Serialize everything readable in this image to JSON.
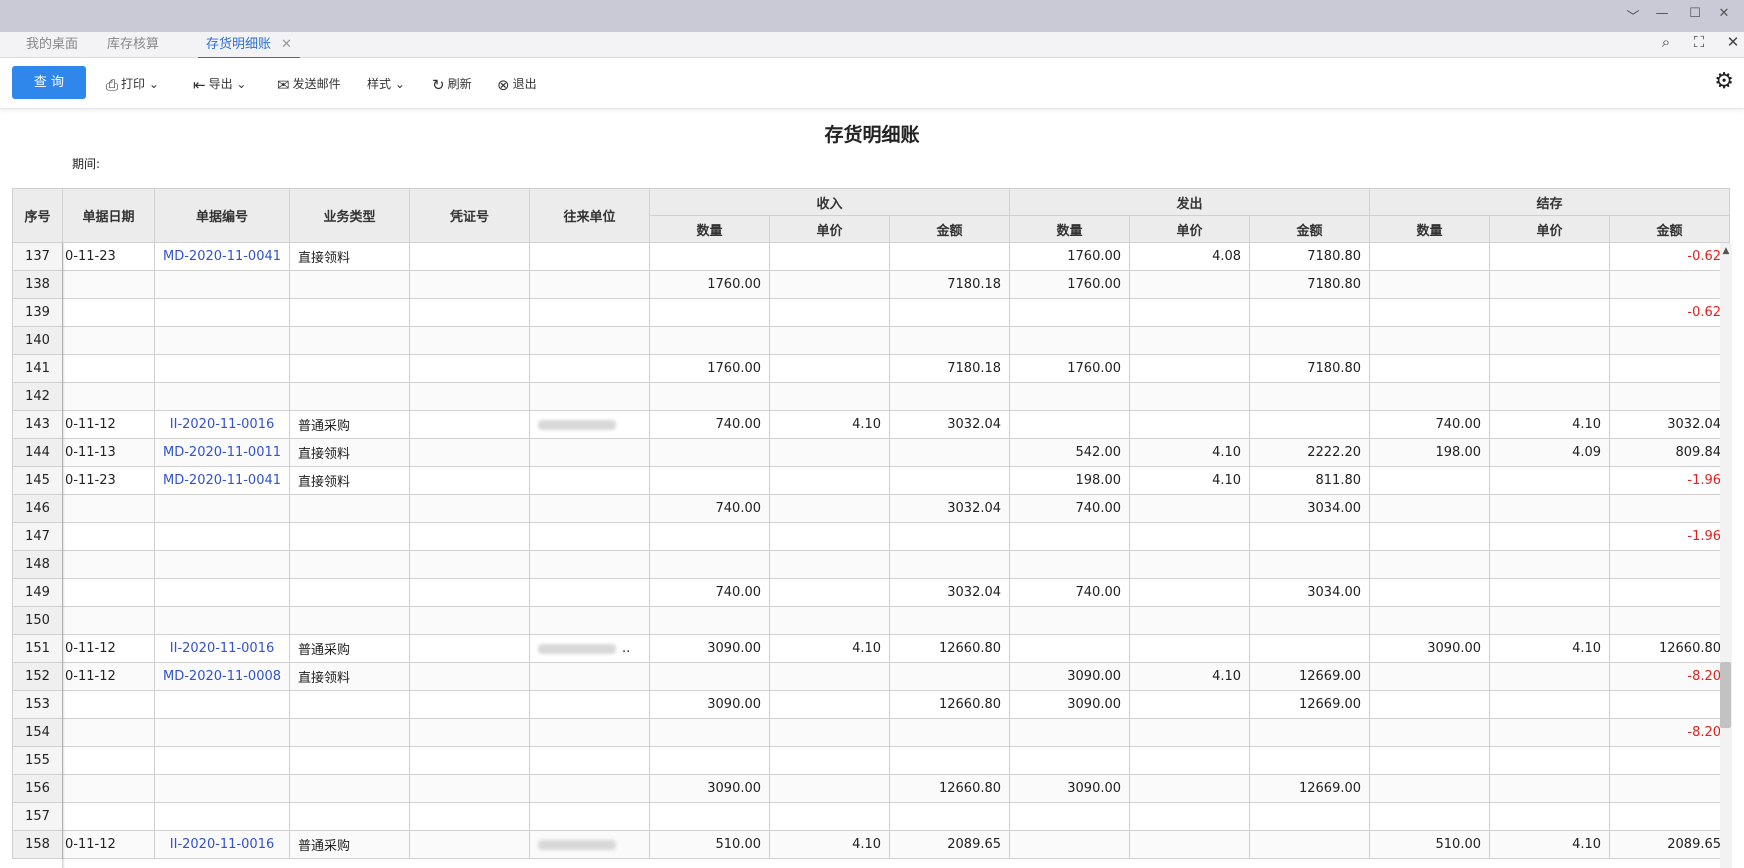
{
  "window": {
    "ctl_min": "﹀",
    "ctl_dash": "—",
    "ctl_max": "☐",
    "ctl_close": "✕"
  },
  "tabs": [
    {
      "label": "我的桌面"
    },
    {
      "label": "库存核算"
    },
    {
      "label": "存货明细账",
      "close": "✕"
    }
  ],
  "tabbar_icons": {
    "search": "⌕",
    "expand": "⛶",
    "close": "✕"
  },
  "toolbar": {
    "query": "查 询",
    "print": "打印",
    "export": "导出",
    "send_mail": "发送邮件",
    "style": "样式",
    "refresh": "刷新",
    "exit": "退出",
    "chev": "⌄",
    "icons": {
      "print": "⎙",
      "export": "⇤",
      "mail": "✉",
      "refresh": "↻",
      "exit": "⊗",
      "gear": "⚙"
    }
  },
  "report": {
    "title": "存货明细账",
    "period_label": "期间:"
  },
  "columns": {
    "seq": "序号",
    "date": "单据日期",
    "bill_no": "单据编号",
    "biz_type": "业务类型",
    "voucher": "凭证号",
    "partner": "往来单位",
    "groups": {
      "in": "收入",
      "out": "发出",
      "balance": "结存"
    },
    "qty": "数量",
    "price": "单价",
    "amount": "金额"
  },
  "rows": [
    {
      "seq": "137",
      "date": "0-11-23",
      "bill": "MD-2020-11-0041",
      "type": "直接领料",
      "partner": "",
      "in_q": "",
      "in_p": "",
      "in_a": "",
      "out_q": "1760.00",
      "out_p": "4.08",
      "out_a": "7180.80",
      "b_q": "",
      "b_p": "",
      "b_a": "-0.62",
      "b_neg": true
    },
    {
      "seq": "138",
      "date": "",
      "bill": "",
      "type": "",
      "partner": "",
      "in_q": "1760.00",
      "in_p": "",
      "in_a": "7180.18",
      "out_q": "1760.00",
      "out_p": "",
      "out_a": "7180.80",
      "b_q": "",
      "b_p": "",
      "b_a": ""
    },
    {
      "seq": "139",
      "date": "",
      "bill": "",
      "type": "",
      "partner": "",
      "in_q": "",
      "in_p": "",
      "in_a": "",
      "out_q": "",
      "out_p": "",
      "out_a": "",
      "b_q": "",
      "b_p": "",
      "b_a": "-0.62",
      "b_neg": true
    },
    {
      "seq": "140",
      "date": "",
      "bill": "",
      "type": "",
      "partner": "",
      "in_q": "",
      "in_p": "",
      "in_a": "",
      "out_q": "",
      "out_p": "",
      "out_a": "",
      "b_q": "",
      "b_p": "",
      "b_a": ""
    },
    {
      "seq": "141",
      "date": "",
      "bill": "",
      "type": "",
      "partner": "",
      "in_q": "1760.00",
      "in_p": "",
      "in_a": "7180.18",
      "out_q": "1760.00",
      "out_p": "",
      "out_a": "7180.80",
      "b_q": "",
      "b_p": "",
      "b_a": ""
    },
    {
      "seq": "142",
      "date": "",
      "bill": "",
      "type": "",
      "partner": "",
      "in_q": "",
      "in_p": "",
      "in_a": "",
      "out_q": "",
      "out_p": "",
      "out_a": "",
      "b_q": "",
      "b_p": "",
      "b_a": ""
    },
    {
      "seq": "143",
      "date": "0-11-12",
      "bill": "II-2020-11-0016",
      "type": "普通采购",
      "partner": "blur",
      "in_q": "740.00",
      "in_p": "4.10",
      "in_a": "3032.04",
      "out_q": "",
      "out_p": "",
      "out_a": "",
      "b_q": "740.00",
      "b_p": "4.10",
      "b_a": "3032.04"
    },
    {
      "seq": "144",
      "date": "0-11-13",
      "bill": "MD-2020-11-0011",
      "type": "直接领料",
      "partner": "",
      "in_q": "",
      "in_p": "",
      "in_a": "",
      "out_q": "542.00",
      "out_p": "4.10",
      "out_a": "2222.20",
      "b_q": "198.00",
      "b_p": "4.09",
      "b_a": "809.84"
    },
    {
      "seq": "145",
      "date": "0-11-23",
      "bill": "MD-2020-11-0041",
      "type": "直接领料",
      "partner": "",
      "in_q": "",
      "in_p": "",
      "in_a": "",
      "out_q": "198.00",
      "out_p": "4.10",
      "out_a": "811.80",
      "b_q": "",
      "b_p": "",
      "b_a": "-1.96",
      "b_neg": true
    },
    {
      "seq": "146",
      "date": "",
      "bill": "",
      "type": "",
      "partner": "",
      "in_q": "740.00",
      "in_p": "",
      "in_a": "3032.04",
      "out_q": "740.00",
      "out_p": "",
      "out_a": "3034.00",
      "b_q": "",
      "b_p": "",
      "b_a": ""
    },
    {
      "seq": "147",
      "date": "",
      "bill": "",
      "type": "",
      "partner": "",
      "in_q": "",
      "in_p": "",
      "in_a": "",
      "out_q": "",
      "out_p": "",
      "out_a": "",
      "b_q": "",
      "b_p": "",
      "b_a": "-1.96",
      "b_neg": true
    },
    {
      "seq": "148",
      "date": "",
      "bill": "",
      "type": "",
      "partner": "",
      "in_q": "",
      "in_p": "",
      "in_a": "",
      "out_q": "",
      "out_p": "",
      "out_a": "",
      "b_q": "",
      "b_p": "",
      "b_a": ""
    },
    {
      "seq": "149",
      "date": "",
      "bill": "",
      "type": "",
      "partner": "",
      "in_q": "740.00",
      "in_p": "",
      "in_a": "3032.04",
      "out_q": "740.00",
      "out_p": "",
      "out_a": "3034.00",
      "b_q": "",
      "b_p": "",
      "b_a": ""
    },
    {
      "seq": "150",
      "date": "",
      "bill": "",
      "type": "",
      "partner": "",
      "in_q": "",
      "in_p": "",
      "in_a": "",
      "out_q": "",
      "out_p": "",
      "out_a": "",
      "b_q": "",
      "b_p": "",
      "b_a": ""
    },
    {
      "seq": "151",
      "date": "0-11-12",
      "bill": "II-2020-11-0016",
      "type": "普通采购",
      "partner": "blur..",
      "in_q": "3090.00",
      "in_p": "4.10",
      "in_a": "12660.80",
      "out_q": "",
      "out_p": "",
      "out_a": "",
      "b_q": "3090.00",
      "b_p": "4.10",
      "b_a": "12660.80"
    },
    {
      "seq": "152",
      "date": "0-11-12",
      "bill": "MD-2020-11-0008",
      "type": "直接领料",
      "partner": "",
      "in_q": "",
      "in_p": "",
      "in_a": "",
      "out_q": "3090.00",
      "out_p": "4.10",
      "out_a": "12669.00",
      "b_q": "",
      "b_p": "",
      "b_a": "-8.20",
      "b_neg": true
    },
    {
      "seq": "153",
      "date": "",
      "bill": "",
      "type": "",
      "partner": "",
      "in_q": "3090.00",
      "in_p": "",
      "in_a": "12660.80",
      "out_q": "3090.00",
      "out_p": "",
      "out_a": "12669.00",
      "b_q": "",
      "b_p": "",
      "b_a": ""
    },
    {
      "seq": "154",
      "date": "",
      "bill": "",
      "type": "",
      "partner": "",
      "in_q": "",
      "in_p": "",
      "in_a": "",
      "out_q": "",
      "out_p": "",
      "out_a": "",
      "b_q": "",
      "b_p": "",
      "b_a": "-8.20",
      "b_neg": true
    },
    {
      "seq": "155",
      "date": "",
      "bill": "",
      "type": "",
      "partner": "",
      "in_q": "",
      "in_p": "",
      "in_a": "",
      "out_q": "",
      "out_p": "",
      "out_a": "",
      "b_q": "",
      "b_p": "",
      "b_a": ""
    },
    {
      "seq": "156",
      "date": "",
      "bill": "",
      "type": "",
      "partner": "",
      "in_q": "3090.00",
      "in_p": "",
      "in_a": "12660.80",
      "out_q": "3090.00",
      "out_p": "",
      "out_a": "12669.00",
      "b_q": "",
      "b_p": "",
      "b_a": ""
    },
    {
      "seq": "157",
      "date": "",
      "bill": "",
      "type": "",
      "partner": "",
      "in_q": "",
      "in_p": "",
      "in_a": "",
      "out_q": "",
      "out_p": "",
      "out_a": "",
      "b_q": "",
      "b_p": "",
      "b_a": ""
    },
    {
      "seq": "158",
      "date": "0-11-12",
      "bill": "II-2020-11-0016",
      "type": "普通采购",
      "partner": "blur",
      "in_q": "510.00",
      "in_p": "4.10",
      "in_a": "2089.65",
      "out_q": "",
      "out_p": "",
      "out_a": "",
      "b_q": "510.00",
      "b_p": "4.10",
      "b_a": "2089.65"
    }
  ],
  "colors": {
    "accent": "#2f86eb",
    "link": "#3352cc",
    "negative": "#e02020"
  }
}
